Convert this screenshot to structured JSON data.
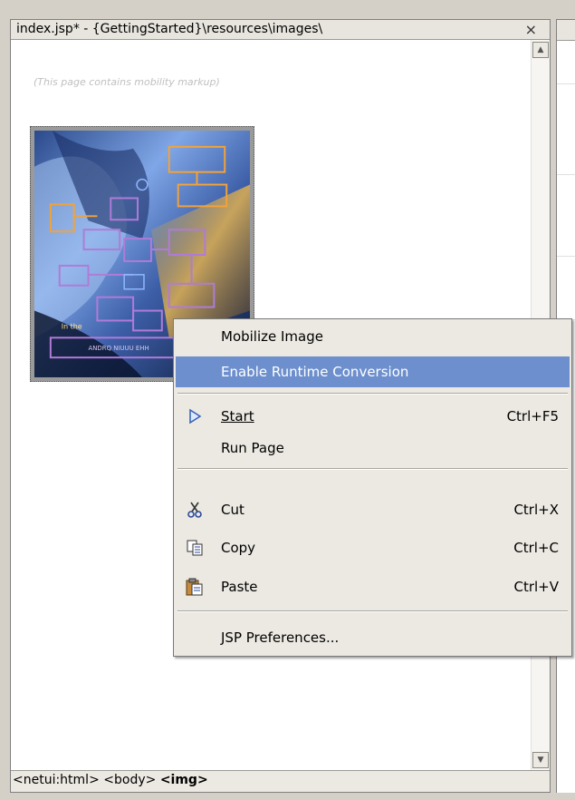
{
  "editor": {
    "tab_title": "index.jsp* - {GettingStarted}\\resources\\images\\",
    "close_glyph": "×",
    "mobility_note": "(This page contains mobility markup)"
  },
  "statusbar": {
    "tag_html": "<netui:html>",
    "tag_body": "<body>",
    "tag_img": "<img>"
  },
  "context_menu": {
    "items": [
      {
        "label": "Mobilize Image",
        "shortcut": "",
        "icon": ""
      },
      {
        "label": "Enable Runtime Conversion",
        "shortcut": "",
        "icon": "",
        "highlighted": true
      },
      {
        "label": "Start",
        "shortcut": "Ctrl+F5",
        "icon": "run-triangle-icon"
      },
      {
        "label": "Run Page",
        "shortcut": "",
        "icon": ""
      },
      {
        "label": "Cut",
        "shortcut": "Ctrl+X",
        "icon": "scissors-icon"
      },
      {
        "label": "Copy",
        "shortcut": "Ctrl+C",
        "icon": "copy-icon"
      },
      {
        "label": "Paste",
        "shortcut": "Ctrl+V",
        "icon": "paste-icon"
      },
      {
        "label": "JSP Preferences...",
        "shortcut": "",
        "icon": ""
      }
    ]
  },
  "colors": {
    "menu_highlight": "#6d8fcd",
    "menu_background": "#ece9e2",
    "chrome": "#d4d0c8"
  }
}
